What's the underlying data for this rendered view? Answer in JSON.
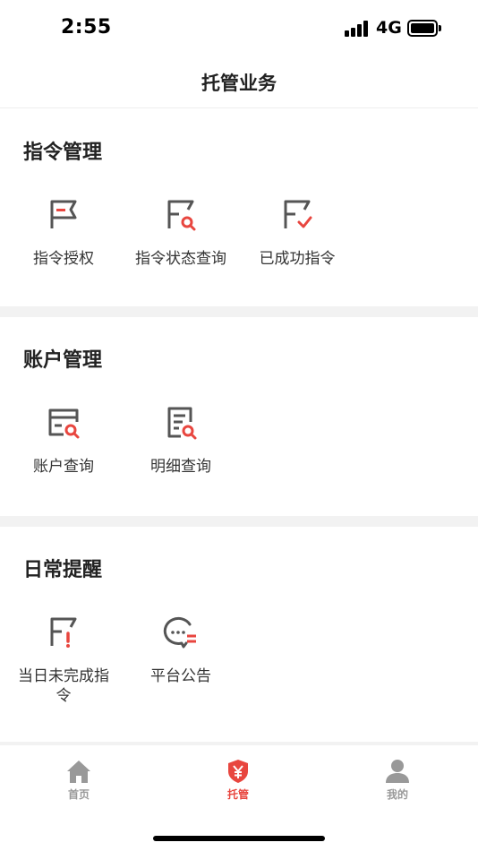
{
  "status_bar": {
    "time": "2:55",
    "network": "4G"
  },
  "nav": {
    "title": "托管业务"
  },
  "colors": {
    "accent": "#e8463f",
    "icon_gray": "#555555",
    "tab_inactive": "#999999"
  },
  "sections": [
    {
      "title": "指令管理",
      "items": [
        {
          "label": "指令授权",
          "icon": "flag-icon"
        },
        {
          "label": "指令状态查询",
          "icon": "flag-search-icon"
        },
        {
          "label": "已成功指令",
          "icon": "flag-check-icon"
        }
      ]
    },
    {
      "title": "账户管理",
      "items": [
        {
          "label": "账户查询",
          "icon": "card-search-icon"
        },
        {
          "label": "明细查询",
          "icon": "document-search-icon"
        }
      ]
    },
    {
      "title": "日常提醒",
      "items": [
        {
          "label": "当日未完成指令",
          "icon": "flag-alert-icon"
        },
        {
          "label": "平台公告",
          "icon": "chat-bubble-icon"
        }
      ]
    }
  ],
  "tabbar": {
    "items": [
      {
        "label": "首页",
        "icon": "home-icon",
        "active": false
      },
      {
        "label": "托管",
        "icon": "shield-yen-icon",
        "active": true
      },
      {
        "label": "我的",
        "icon": "person-icon",
        "active": false
      }
    ]
  }
}
